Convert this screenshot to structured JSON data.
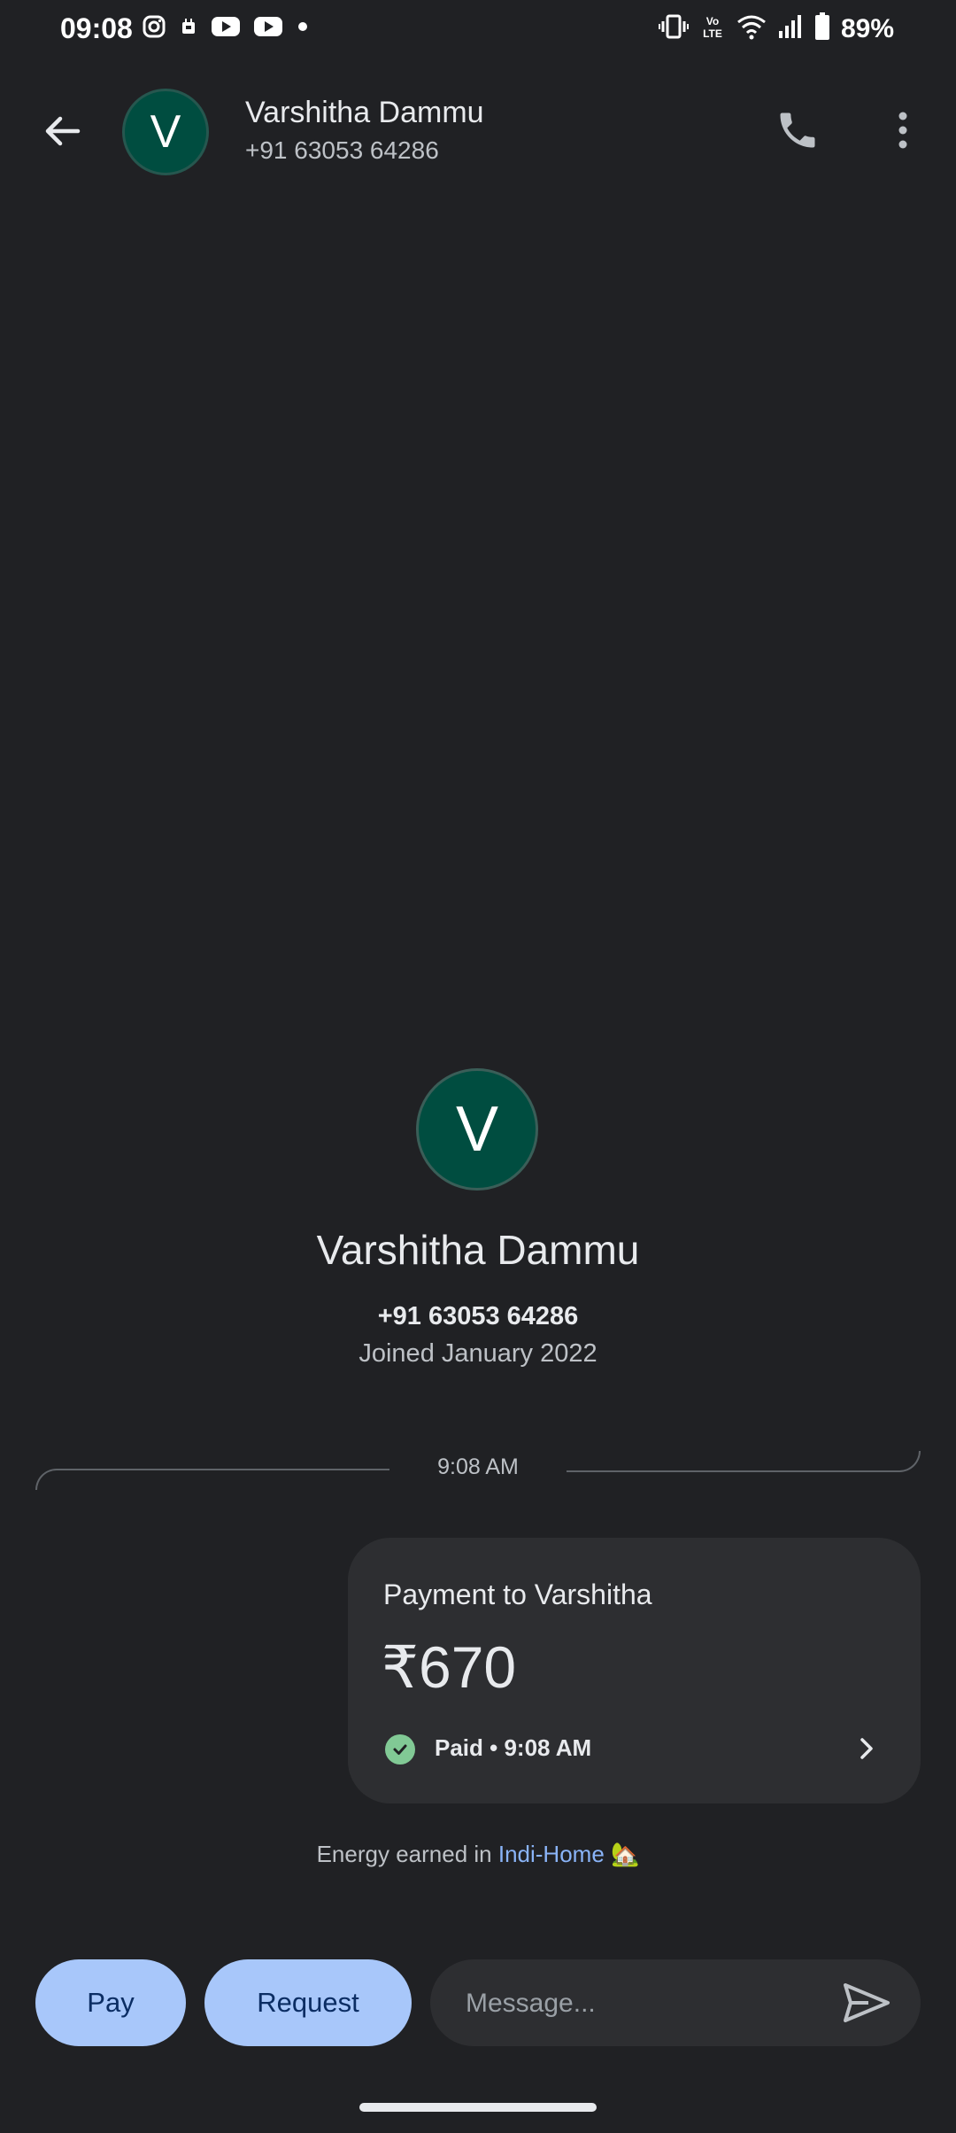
{
  "status_bar": {
    "time": "09:08",
    "battery": "89%",
    "network": "Vo LTE"
  },
  "header": {
    "avatar_letter": "V",
    "name": "Varshitha Dammu",
    "phone": "+91 63053 64286"
  },
  "profile": {
    "avatar_letter": "V",
    "name": "Varshitha Dammu",
    "phone": "+91 63053 64286",
    "joined": "Joined January 2022"
  },
  "divider": {
    "time": "9:08 AM"
  },
  "payment": {
    "title": "Payment to Varshitha",
    "amount": "₹670",
    "status": "Paid • 9:08 AM"
  },
  "energy": {
    "prefix": "Energy earned in ",
    "link": "Indi-Home",
    "emoji": "🏡"
  },
  "bottom_bar": {
    "pay_label": "Pay",
    "request_label": "Request",
    "message_placeholder": "Message..."
  },
  "colors": {
    "background": "#202124",
    "avatar": "#004d40",
    "accent_button": "#a8c7fa",
    "paid_green": "#81c995",
    "link_blue": "#8ab4f8"
  }
}
